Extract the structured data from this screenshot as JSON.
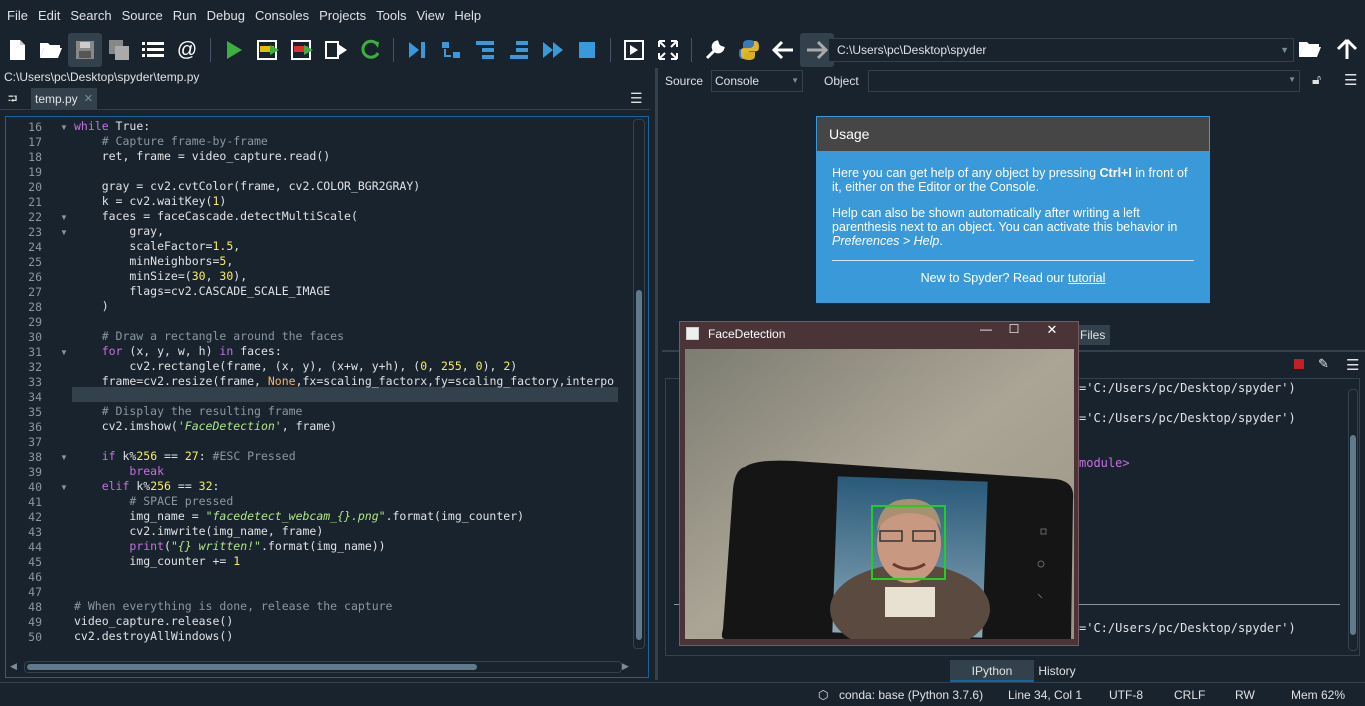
{
  "menu": [
    "File",
    "Edit",
    "Search",
    "Source",
    "Run",
    "Debug",
    "Consoles",
    "Projects",
    "Tools",
    "View",
    "Help"
  ],
  "toolbar": {
    "path": "C:\\Users\\pc\\Desktop\\spyder"
  },
  "editor": {
    "filepath": "C:\\Users\\pc\\Desktop\\spyder\\temp.py",
    "tab_label": "temp.py",
    "tab_close": "✕",
    "line_numbers": [
      "16",
      "17",
      "18",
      "19",
      "20",
      "21",
      "22",
      "23",
      "24",
      "25",
      "26",
      "27",
      "28",
      "29",
      "30",
      "31",
      "32",
      "33",
      "34",
      "35",
      "36",
      "37",
      "38",
      "39",
      "40",
      "41",
      "42",
      "43",
      "44",
      "45",
      "46",
      "47",
      "48",
      "49",
      "50"
    ]
  },
  "help": {
    "source_label": "Source",
    "source_value": "Console",
    "object_label": "Object",
    "usage_title": "Usage",
    "usage_p1a": "Here you can get help of any object by pressing ",
    "usage_p1b": "Ctrl+I",
    "usage_p1c": " in front of it, either on the Editor or the Console.",
    "usage_p2a": "Help can also be shown automatically after writing a left parenthesis next to an object. You can activate this behavior in ",
    "usage_p2b": "Preferences > Help",
    "usage_p2c": ".",
    "usage_p3a": "New to Spyder? Read our ",
    "usage_p3b": "tutorial",
    "files_tab": "Files"
  },
  "facewindow": {
    "title": "FaceDetection"
  },
  "console": {
    "path_text": "='C:/Users/pc/Desktop/spyder')",
    "module_text": "module>",
    "tabs": [
      "IPython console",
      "History"
    ]
  },
  "status": {
    "env": "conda: base (Python 3.7.6)",
    "position": "Line 34, Col 1",
    "encoding": "UTF-8",
    "eol": "CRLF",
    "perm": "RW",
    "mem": "Mem 62%"
  },
  "colors": {
    "accent": "#3a9ad9",
    "bg": "#19232d",
    "panel": "#32414b"
  }
}
